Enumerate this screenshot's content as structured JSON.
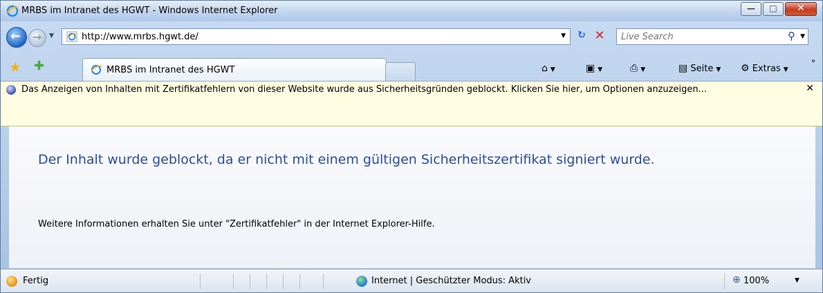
{
  "window": {
    "title": "MRBS im Intranet des HGWT - Windows Internet Explorer",
    "minimize_glyph": "—",
    "maximize_glyph": "□",
    "close_glyph": "✕"
  },
  "address_bar": {
    "url": "http://www.mrbs.hgwt.de/",
    "refresh_glyph": "↻",
    "stop_glyph": "✕"
  },
  "search": {
    "placeholder": "Live Search",
    "icon": "search-icon"
  },
  "tabs": [
    {
      "label": "MRBS im Intranet des HGWT",
      "active": true
    }
  ],
  "commands": {
    "home_icon": "home-icon",
    "feeds_icon": "feeds-icon",
    "print_icon": "print-icon",
    "page_label": "Seite",
    "tools_label": "Extras"
  },
  "infobar": {
    "message": "Das Anzeigen von Inhalten mit Zertifikatfehlern von dieser Website wurde aus Sicherheitsgründen geblockt. Klicken Sie hier, um Optionen anzuzeigen...",
    "close_glyph": "✕"
  },
  "content": {
    "headline": "Der Inhalt wurde geblockt, da er nicht mit einem gültigen Sicherheitszertifikat signiert wurde.",
    "info": "Weitere Informationen erhalten Sie unter \"Zertifikatfehler\" in der Internet Explorer-Hilfe."
  },
  "status": {
    "ready": "Fertig",
    "zone": "Internet | Geschützter Modus: Aktiv",
    "zoom": "100%"
  },
  "colors": {
    "headline": "#2b4fa0",
    "infobar_bg": "#fffde1",
    "close_button": "#c43c20"
  }
}
